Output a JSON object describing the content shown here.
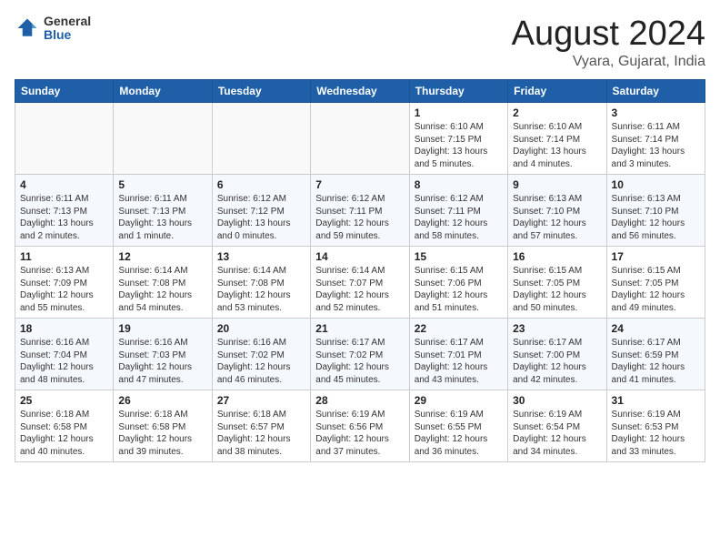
{
  "header": {
    "logo_general": "General",
    "logo_blue": "Blue",
    "title": "August 2024",
    "location": "Vyara, Gujarat, India"
  },
  "weekdays": [
    "Sunday",
    "Monday",
    "Tuesday",
    "Wednesday",
    "Thursday",
    "Friday",
    "Saturday"
  ],
  "weeks": [
    [
      {
        "day": "",
        "info": ""
      },
      {
        "day": "",
        "info": ""
      },
      {
        "day": "",
        "info": ""
      },
      {
        "day": "",
        "info": ""
      },
      {
        "day": "1",
        "info": "Sunrise: 6:10 AM\nSunset: 7:15 PM\nDaylight: 13 hours\nand 5 minutes."
      },
      {
        "day": "2",
        "info": "Sunrise: 6:10 AM\nSunset: 7:14 PM\nDaylight: 13 hours\nand 4 minutes."
      },
      {
        "day": "3",
        "info": "Sunrise: 6:11 AM\nSunset: 7:14 PM\nDaylight: 13 hours\nand 3 minutes."
      }
    ],
    [
      {
        "day": "4",
        "info": "Sunrise: 6:11 AM\nSunset: 7:13 PM\nDaylight: 13 hours\nand 2 minutes."
      },
      {
        "day": "5",
        "info": "Sunrise: 6:11 AM\nSunset: 7:13 PM\nDaylight: 13 hours\nand 1 minute."
      },
      {
        "day": "6",
        "info": "Sunrise: 6:12 AM\nSunset: 7:12 PM\nDaylight: 13 hours\nand 0 minutes."
      },
      {
        "day": "7",
        "info": "Sunrise: 6:12 AM\nSunset: 7:11 PM\nDaylight: 12 hours\nand 59 minutes."
      },
      {
        "day": "8",
        "info": "Sunrise: 6:12 AM\nSunset: 7:11 PM\nDaylight: 12 hours\nand 58 minutes."
      },
      {
        "day": "9",
        "info": "Sunrise: 6:13 AM\nSunset: 7:10 PM\nDaylight: 12 hours\nand 57 minutes."
      },
      {
        "day": "10",
        "info": "Sunrise: 6:13 AM\nSunset: 7:10 PM\nDaylight: 12 hours\nand 56 minutes."
      }
    ],
    [
      {
        "day": "11",
        "info": "Sunrise: 6:13 AM\nSunset: 7:09 PM\nDaylight: 12 hours\nand 55 minutes."
      },
      {
        "day": "12",
        "info": "Sunrise: 6:14 AM\nSunset: 7:08 PM\nDaylight: 12 hours\nand 54 minutes."
      },
      {
        "day": "13",
        "info": "Sunrise: 6:14 AM\nSunset: 7:08 PM\nDaylight: 12 hours\nand 53 minutes."
      },
      {
        "day": "14",
        "info": "Sunrise: 6:14 AM\nSunset: 7:07 PM\nDaylight: 12 hours\nand 52 minutes."
      },
      {
        "day": "15",
        "info": "Sunrise: 6:15 AM\nSunset: 7:06 PM\nDaylight: 12 hours\nand 51 minutes."
      },
      {
        "day": "16",
        "info": "Sunrise: 6:15 AM\nSunset: 7:05 PM\nDaylight: 12 hours\nand 50 minutes."
      },
      {
        "day": "17",
        "info": "Sunrise: 6:15 AM\nSunset: 7:05 PM\nDaylight: 12 hours\nand 49 minutes."
      }
    ],
    [
      {
        "day": "18",
        "info": "Sunrise: 6:16 AM\nSunset: 7:04 PM\nDaylight: 12 hours\nand 48 minutes."
      },
      {
        "day": "19",
        "info": "Sunrise: 6:16 AM\nSunset: 7:03 PM\nDaylight: 12 hours\nand 47 minutes."
      },
      {
        "day": "20",
        "info": "Sunrise: 6:16 AM\nSunset: 7:02 PM\nDaylight: 12 hours\nand 46 minutes."
      },
      {
        "day": "21",
        "info": "Sunrise: 6:17 AM\nSunset: 7:02 PM\nDaylight: 12 hours\nand 45 minutes."
      },
      {
        "day": "22",
        "info": "Sunrise: 6:17 AM\nSunset: 7:01 PM\nDaylight: 12 hours\nand 43 minutes."
      },
      {
        "day": "23",
        "info": "Sunrise: 6:17 AM\nSunset: 7:00 PM\nDaylight: 12 hours\nand 42 minutes."
      },
      {
        "day": "24",
        "info": "Sunrise: 6:17 AM\nSunset: 6:59 PM\nDaylight: 12 hours\nand 41 minutes."
      }
    ],
    [
      {
        "day": "25",
        "info": "Sunrise: 6:18 AM\nSunset: 6:58 PM\nDaylight: 12 hours\nand 40 minutes."
      },
      {
        "day": "26",
        "info": "Sunrise: 6:18 AM\nSunset: 6:58 PM\nDaylight: 12 hours\nand 39 minutes."
      },
      {
        "day": "27",
        "info": "Sunrise: 6:18 AM\nSunset: 6:57 PM\nDaylight: 12 hours\nand 38 minutes."
      },
      {
        "day": "28",
        "info": "Sunrise: 6:19 AM\nSunset: 6:56 PM\nDaylight: 12 hours\nand 37 minutes."
      },
      {
        "day": "29",
        "info": "Sunrise: 6:19 AM\nSunset: 6:55 PM\nDaylight: 12 hours\nand 36 minutes."
      },
      {
        "day": "30",
        "info": "Sunrise: 6:19 AM\nSunset: 6:54 PM\nDaylight: 12 hours\nand 34 minutes."
      },
      {
        "day": "31",
        "info": "Sunrise: 6:19 AM\nSunset: 6:53 PM\nDaylight: 12 hours\nand 33 minutes."
      }
    ]
  ]
}
